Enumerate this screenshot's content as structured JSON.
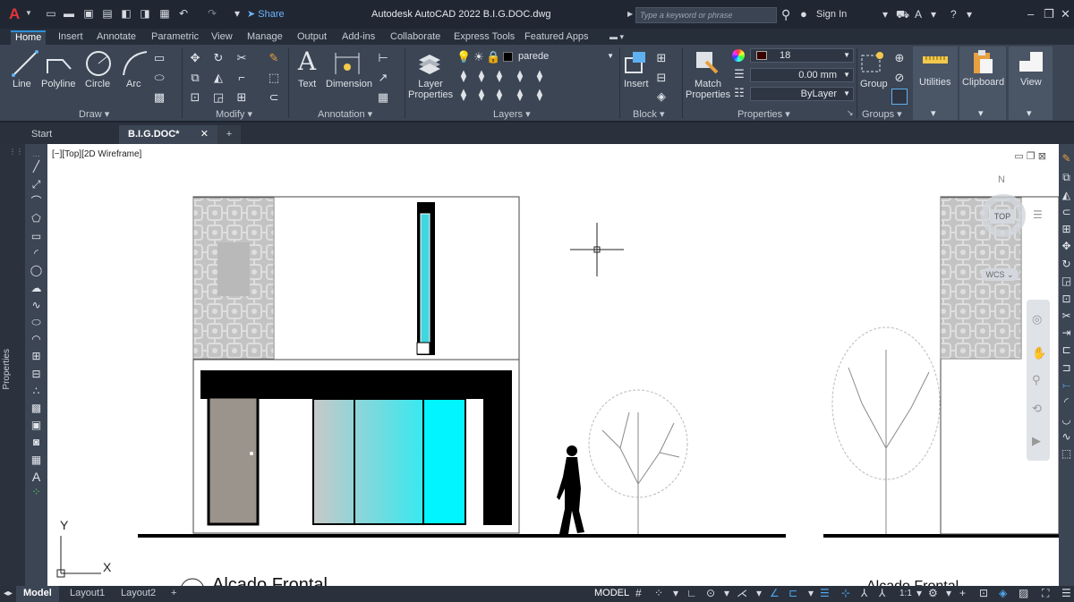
{
  "titlebar": {
    "logo": "A",
    "share": "Share",
    "title": "Autodesk AutoCAD 2022    B.I.G.DOC.dwg",
    "search_placeholder": "Type a keyword or phrase",
    "sign_in": "Sign In"
  },
  "ribbon_tabs": [
    "Home",
    "Insert",
    "Annotate",
    "Parametric",
    "View",
    "Manage",
    "Output",
    "Add-ins",
    "Collaborate",
    "Express Tools",
    "Featured Apps"
  ],
  "ribbon": {
    "draw": {
      "line": "Line",
      "polyline": "Polyline",
      "circle": "Circle",
      "arc": "Arc",
      "panel": "Draw"
    },
    "modify": {
      "panel": "Modify"
    },
    "annotation": {
      "text": "Text",
      "dimension": "Dimension",
      "panel": "Annotation"
    },
    "layers": {
      "layer_properties": "Layer Properties",
      "current_layer": "parede",
      "panel": "Layers"
    },
    "block": {
      "insert": "Insert",
      "panel": "Block"
    },
    "properties": {
      "match": "Match Properties",
      "color": "18",
      "lineweight": "0.00 mm",
      "linetype": "ByLayer",
      "panel": "Properties"
    },
    "groups": {
      "group": "Group",
      "panel": "Groups"
    },
    "utilities": "Utilities",
    "clipboard": "Clipboard",
    "view": "View"
  },
  "doc_tabs": {
    "start": "Start",
    "file": "B.I.G.DOC*"
  },
  "left_panel": {
    "properties": "Properties"
  },
  "canvas": {
    "viewport_label": "[−][Top][2D Wireframe]",
    "view_cube": {
      "top": "TOP",
      "north": "N",
      "wcs": "WCS"
    },
    "ucs": {
      "x": "X",
      "y": "Y"
    },
    "drawing_title": "Alcado Frontal",
    "drawing_title_2": "Alcado Frontal"
  },
  "status": {
    "tabs": [
      "Model",
      "Layout1",
      "Layout2"
    ],
    "model": "MODEL",
    "scale": "1:1"
  },
  "colors": {
    "glass": "#00f5ff",
    "door": "#9b948c",
    "panel_grey": "#c9c9c9",
    "accent": "#2f8fd8"
  }
}
